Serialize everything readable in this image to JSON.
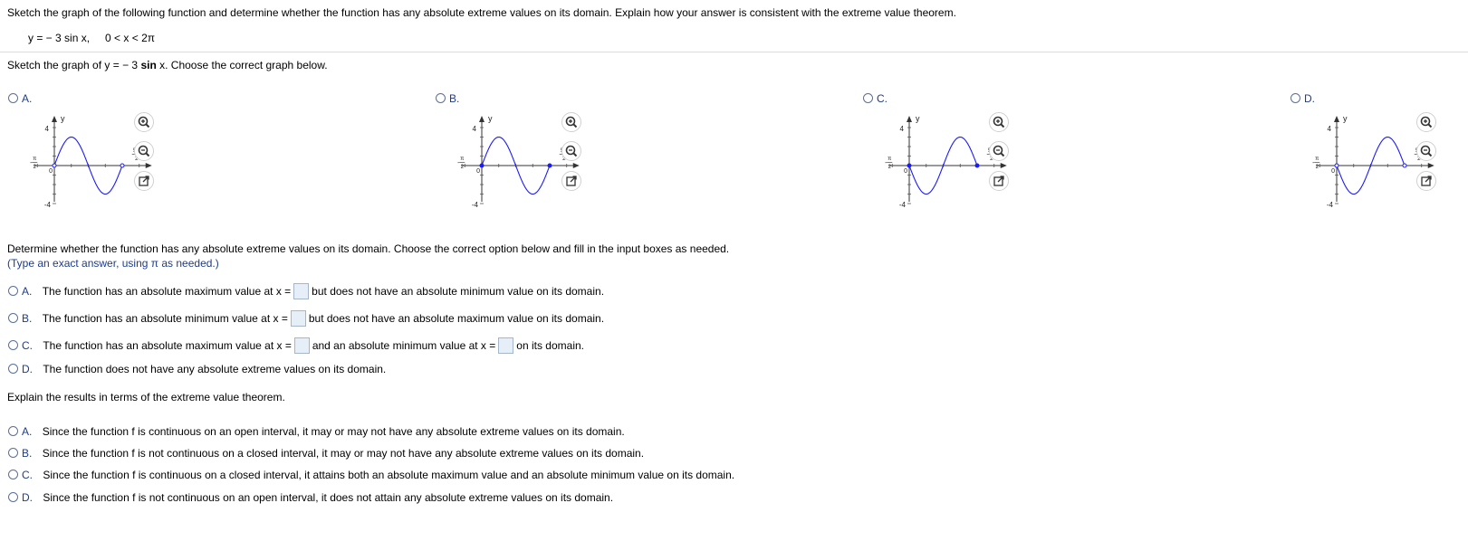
{
  "question": {
    "instruction": "Sketch the graph of the following function and determine whether the function has any absolute extreme values on its domain. Explain how your answer is consistent with the extreme value theorem.",
    "function_lhs": "y = − 3 sin x,",
    "function_domain": "0 < x < 2π"
  },
  "part1": {
    "prompt_prefix": "Sketch the graph of y = − 3 ",
    "prompt_bold": "sin",
    "prompt_suffix": " x. Choose the correct graph below.",
    "options": [
      {
        "letter": "A.",
        "y_top": "4",
        "y_bottom": "-4",
        "x_label": "x",
        "y_label": "y",
        "neg_half_pi_num": "π",
        "neg_half_pi_den": "2",
        "five_half_pi_num": "5π",
        "five_half_pi_den": "2",
        "zero": "0"
      },
      {
        "letter": "B.",
        "y_top": "4",
        "y_bottom": "-4",
        "x_label": "x",
        "y_label": "y",
        "neg_half_pi_num": "π",
        "neg_half_pi_den": "2",
        "five_half_pi_num": "5π",
        "five_half_pi_den": "2",
        "zero": "0"
      },
      {
        "letter": "C.",
        "y_top": "4",
        "y_bottom": "-4",
        "x_label": "x",
        "y_label": "y",
        "neg_half_pi_num": "π",
        "neg_half_pi_den": "2",
        "five_half_pi_num": "5π",
        "five_half_pi_den": "2",
        "zero": "0"
      },
      {
        "letter": "D.",
        "y_top": "4",
        "y_bottom": "-4",
        "x_label": "x",
        "y_label": "y",
        "neg_half_pi_num": "π",
        "neg_half_pi_den": "2",
        "five_half_pi_num": "5π",
        "five_half_pi_den": "2",
        "zero": "0"
      }
    ],
    "icons": [
      "zoom-in-icon",
      "zoom-out-icon",
      "popout-icon"
    ]
  },
  "part2": {
    "prompt": "Determine whether the function has any absolute extreme values on its domain. Choose the correct option below and fill in the input boxes as needed.",
    "hint": "(Type an exact answer, using π as needed.)",
    "options": [
      {
        "letter": "A.",
        "text1": "The function has an absolute maximum value at x =",
        "text2": "but does not have an absolute minimum value on its domain."
      },
      {
        "letter": "B.",
        "text1": "The function has an absolute minimum value at x =",
        "text2": "but does not have an absolute  maximum value on its domain."
      },
      {
        "letter": "C.",
        "text1": "The function has an absolute maximum value at x =",
        "text2": "and an absolute minimum value at x =",
        "text3": "on its domain."
      },
      {
        "letter": "D.",
        "text1": "The function does not have any absolute extreme values on its domain."
      }
    ]
  },
  "part3": {
    "prompt": "Explain the results in terms of the extreme value theorem.",
    "options": [
      {
        "letter": "A.",
        "text": "Since the function f is continuous on an open interval, it may or may not have any absolute extreme values on its domain."
      },
      {
        "letter": "B.",
        "text": "Since the function f is not continuous on a closed interval, it may or may not have any absolute extreme values on its domain."
      },
      {
        "letter": "C.",
        "text": "Since the function f is continuous on a closed interval, it attains both an absolute maximum value and an absolute minimum value on its domain."
      },
      {
        "letter": "D.",
        "text": "Since the function f is not continuous on an open interval, it does not attain any absolute extreme values on its domain."
      }
    ]
  },
  "colors": {
    "curve": "#1a1aff",
    "option_letter": "#1f3c8a",
    "input_bg": "#e6eef7"
  }
}
